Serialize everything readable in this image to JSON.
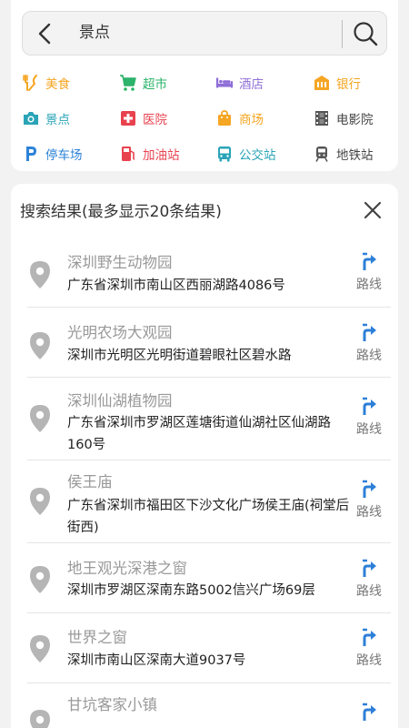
{
  "search": {
    "query": "景点"
  },
  "categories": [
    {
      "label": "美食",
      "icon": "food-icon",
      "color": "#f5a623"
    },
    {
      "label": "超市",
      "icon": "cart-icon",
      "color": "#2db36b"
    },
    {
      "label": "酒店",
      "icon": "hotel-bed-icon",
      "color": "#8f6fd8"
    },
    {
      "label": "银行",
      "icon": "bank-icon",
      "color": "#f5a623"
    },
    {
      "label": "景点",
      "icon": "camera-icon",
      "color": "#2aa4b7"
    },
    {
      "label": "医院",
      "icon": "hospital-cross-icon",
      "color": "#e8424f"
    },
    {
      "label": "商场",
      "icon": "shopping-bag-icon",
      "color": "#f5a623"
    },
    {
      "label": "电影院",
      "icon": "film-icon",
      "color": "#555555"
    },
    {
      "label": "停车场",
      "icon": "parking-icon",
      "color": "#2d83d8"
    },
    {
      "label": "加油站",
      "icon": "gas-station-icon",
      "color": "#e8424f"
    },
    {
      "label": "公交站",
      "icon": "bus-icon",
      "color": "#2aa4b7"
    },
    {
      "label": "地铁站",
      "icon": "subway-icon",
      "color": "#555555"
    }
  ],
  "results": {
    "header": "搜索结果(最多显示20条结果)",
    "route_label": "路线",
    "items": [
      {
        "name": "深圳野生动物园",
        "address": "广东省深圳市南山区西丽湖路4086号"
      },
      {
        "name": "光明农场大观园",
        "address": "深圳市光明区光明街道碧眼社区碧水路"
      },
      {
        "name": "深圳仙湖植物园",
        "address": "广东省深圳市罗湖区莲塘街道仙湖社区仙湖路160号"
      },
      {
        "name": "侯王庙",
        "address": "广东省深圳市福田区下沙文化广场侯王庙(祠堂后街西)"
      },
      {
        "name": "地王观光深港之窗",
        "address": "深圳市罗湖区深南东路5002信兴广场69层"
      },
      {
        "name": "世界之窗",
        "address": "深圳市南山区深南大道9037号"
      },
      {
        "name": "甘坑客家小镇",
        "address": ""
      }
    ]
  },
  "colors": {
    "accent_blue": "#2d7fd8",
    "pin_gray": "#b5b5b5"
  }
}
